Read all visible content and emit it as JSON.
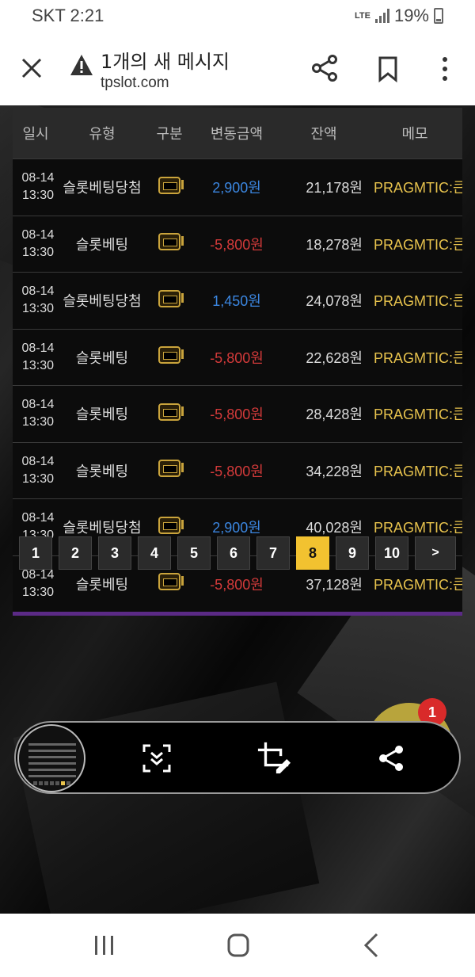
{
  "status": {
    "carrier_time": "SKT 2:21",
    "network": "LTE",
    "battery": "19%"
  },
  "header": {
    "title": "1개의 새 메시지",
    "url": "tpslot.com"
  },
  "table": {
    "headers": [
      "일시",
      "유형",
      "구분",
      "변동금액",
      "잔액",
      "메모"
    ],
    "rows": [
      {
        "date": "08-14",
        "time": "13:30",
        "type": "슬롯베팅당첨",
        "amount": "2,900원",
        "balance": "21,178원",
        "memo": "PRAGMTIC:큰"
      },
      {
        "date": "08-14",
        "time": "13:30",
        "type": "슬롯베팅",
        "amount": "-5,800원",
        "balance": "18,278원",
        "memo": "PRAGMTIC:큰"
      },
      {
        "date": "08-14",
        "time": "13:30",
        "type": "슬롯베팅당첨",
        "amount": "1,450원",
        "balance": "24,078원",
        "memo": "PRAGMTIC:큰"
      },
      {
        "date": "08-14",
        "time": "13:30",
        "type": "슬롯베팅",
        "amount": "-5,800원",
        "balance": "22,628원",
        "memo": "PRAGMTIC:큰"
      },
      {
        "date": "08-14",
        "time": "13:30",
        "type": "슬롯베팅",
        "amount": "-5,800원",
        "balance": "28,428원",
        "memo": "PRAGMTIC:큰"
      },
      {
        "date": "08-14",
        "time": "13:30",
        "type": "슬롯베팅",
        "amount": "-5,800원",
        "balance": "34,228원",
        "memo": "PRAGMTIC:큰"
      },
      {
        "date": "08-14",
        "time": "13:30",
        "type": "슬롯베팅당첨",
        "amount": "2,900원",
        "balance": "40,028원",
        "memo": "PRAGMTIC:큰"
      },
      {
        "date": "08-14",
        "time": "13:30",
        "type": "슬롯베팅",
        "amount": "-5,800원",
        "balance": "37,128원",
        "memo": "PRAGMTIC:큰"
      }
    ]
  },
  "pagination": {
    "pages": [
      "1",
      "2",
      "3",
      "4",
      "5",
      "6",
      "7",
      "8",
      "9",
      "10"
    ],
    "current": "8",
    "next_label": ">"
  },
  "notification_badge": "1",
  "colors": {
    "positive": "#3b86e0",
    "negative": "#d33a3a",
    "memo": "#e8c34d",
    "active_page": "#f2c230",
    "table_bottom_line": "#5b2a86"
  },
  "icons": {
    "close": "close-icon",
    "warning": "warning-icon",
    "share": "share-icon",
    "bookmark": "bookmark-icon",
    "more": "more-vertical-icon",
    "slot": "slot-machine-icon",
    "scroll_capture": "scroll-capture-icon",
    "crop_edit": "crop-edit-icon",
    "nav_recents": "recents-icon",
    "nav_home": "home-icon",
    "nav_back": "back-icon"
  }
}
